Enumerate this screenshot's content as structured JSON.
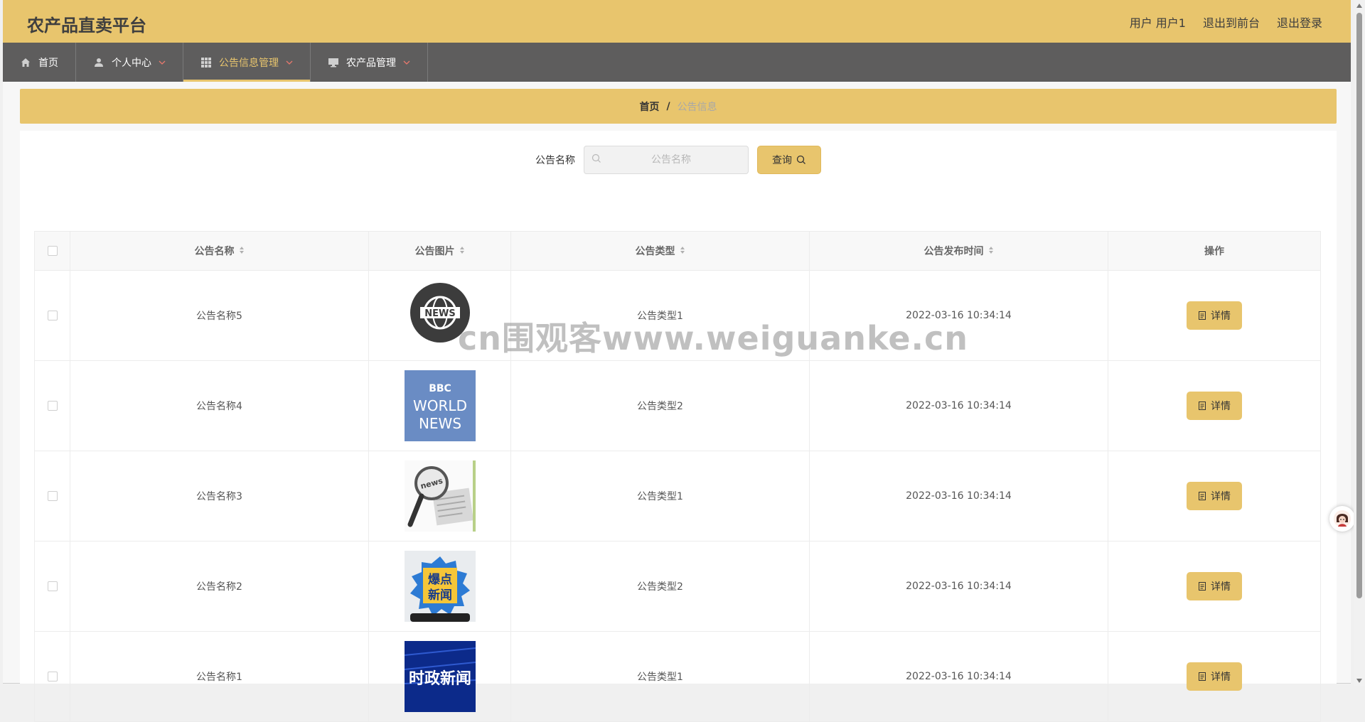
{
  "header": {
    "title": "农产品直卖平台",
    "user_label": "用户 用户1",
    "back_to_front": "退出到前台",
    "logout": "退出登录"
  },
  "nav": {
    "items": [
      {
        "label": "首页",
        "icon": "home-icon"
      },
      {
        "label": "个人中心",
        "icon": "user-icon"
      },
      {
        "label": "公告信息管理",
        "icon": "grid-icon",
        "active": true
      },
      {
        "label": "农产品管理",
        "icon": "monitor-icon"
      }
    ]
  },
  "breadcrumb": {
    "home": "首页",
    "separator": "/",
    "current": "公告信息"
  },
  "search": {
    "label": "公告名称",
    "placeholder": "公告名称",
    "value": "",
    "button": "查询"
  },
  "table": {
    "columns": [
      "公告名称",
      "公告图片",
      "公告类型",
      "公告发布时间",
      "操作"
    ],
    "action_label": "详情",
    "rows": [
      {
        "name": "公告名称5",
        "image": "news-globe-image",
        "type": "公告类型1",
        "time": "2022-03-16 10:34:14"
      },
      {
        "name": "公告名称4",
        "image": "bbc-world-news-image",
        "type": "公告类型2",
        "time": "2022-03-16 10:34:14"
      },
      {
        "name": "公告名称3",
        "image": "magnifier-news-image",
        "type": "公告类型1",
        "time": "2022-03-16 10:34:14"
      },
      {
        "name": "公告名称2",
        "image": "breaking-news-image",
        "type": "公告类型2",
        "time": "2022-03-16 10:34:14"
      },
      {
        "name": "公告名称1",
        "image": "political-news-image",
        "type": "公告类型1",
        "time": "2022-03-16 10:34:14"
      }
    ]
  },
  "images": {
    "bbc_line1": "BBC",
    "bbc_line2": "WORLD",
    "bbc_line3": "NEWS",
    "globe_text": "NEWS",
    "magnifier_text": "news",
    "breaking_line1": "爆点",
    "breaking_line2": "新闻",
    "political_text": "时政新闻"
  },
  "watermark": "cn围观客www.weiguanke.cn",
  "colors": {
    "accent": "#e8c56d",
    "nav_bg": "#5e5d5d"
  }
}
